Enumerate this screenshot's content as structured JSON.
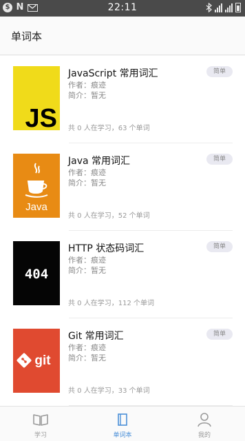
{
  "status_bar": {
    "time": "22:11",
    "icons": [
      "notification-circle-icon",
      "n-app-icon",
      "mail-icon",
      "bluetooth-icon",
      "signal-icon",
      "battery-icon"
    ]
  },
  "header": {
    "title": "单词本"
  },
  "books": [
    {
      "cover_text": "JS",
      "title": "JavaScript 常用词汇",
      "author": "作者：痕迹",
      "intro": "简介：暂无",
      "count": "共 0 人在学习，63 个单词",
      "tag": "简单",
      "cover_bg": "#f0db1a"
    },
    {
      "cover_text": "Java",
      "title": "Java 常用词汇",
      "author": "作者：痕迹",
      "intro": "简介：暂无",
      "count": "共 0 人在学习，52 个单词",
      "tag": "简单",
      "cover_bg": "#e88b14"
    },
    {
      "cover_text": "404",
      "title": "HTTP 状态码词汇",
      "author": "作者：痕迹",
      "intro": "简介：暂无",
      "count": "共 0 人在学习，112 个单词",
      "tag": "简单",
      "cover_bg": "#050505"
    },
    {
      "cover_text": "git",
      "title": "Git 常用词汇",
      "author": "作者：痕迹",
      "intro": "简介：暂无",
      "count": "共 0 人在学习，33 个单词",
      "tag": "简单",
      "cover_bg": "#e04a30"
    }
  ],
  "tabs": [
    {
      "label": "学习",
      "icon": "book-open-icon",
      "active": false
    },
    {
      "label": "单词本",
      "icon": "wordbook-icon",
      "active": true
    },
    {
      "label": "我的",
      "icon": "user-icon",
      "active": false
    }
  ],
  "colors": {
    "accent": "#4a8fd8",
    "status_bar": "#4a4a4a",
    "tag_bg": "#e9e9f1"
  }
}
